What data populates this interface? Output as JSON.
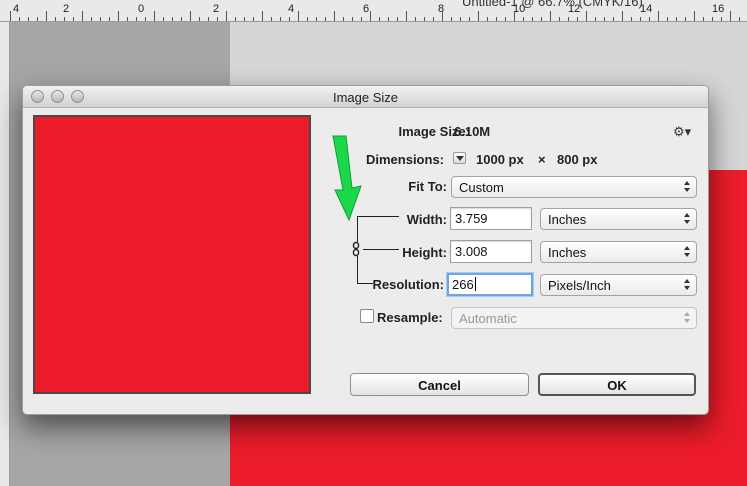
{
  "document": {
    "title": "Untitled-1 @ 66.7% (CMYK/16)",
    "ruler_numbers": [
      "4",
      "2",
      "0",
      "2",
      "4",
      "6",
      "8",
      "10",
      "12",
      "14",
      "16"
    ],
    "canvas_color": "#ec1c2a"
  },
  "dialog": {
    "title": "Image Size",
    "image_size_label": "Image Size:",
    "image_size_value": "6.10M",
    "dimensions_label": "Dimensions:",
    "dimensions_width": "1000 px",
    "dimensions_times": "×",
    "dimensions_height": "800 px",
    "fit_to_label": "Fit To:",
    "fit_to_value": "Custom",
    "width_label": "Width:",
    "width_value": "3.759",
    "width_unit": "Inches",
    "height_label": "Height:",
    "height_value": "3.008",
    "height_unit": "Inches",
    "resolution_label": "Resolution:",
    "resolution_value": "266",
    "resolution_unit": "Pixels/Inch",
    "resample_label": "Resample:",
    "resample_checked": false,
    "resample_value": "Automatic",
    "cancel_label": "Cancel",
    "ok_label": "OK",
    "gear_icon": "gear-icon",
    "link_icon": "chain-link-icon",
    "annotation_arrow_color": "#1bd84a"
  }
}
